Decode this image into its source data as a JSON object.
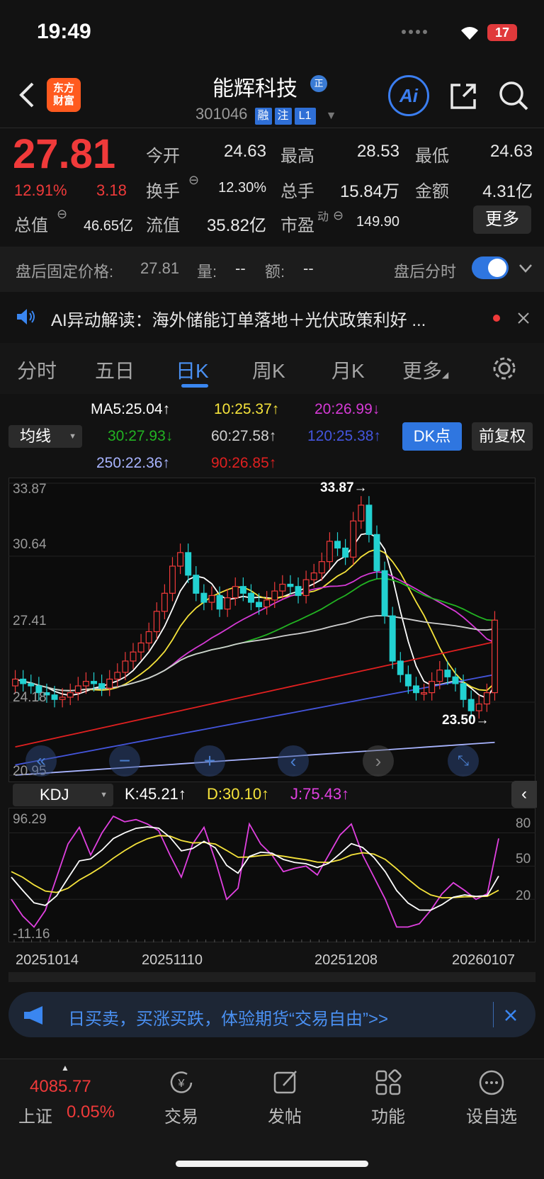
{
  "status_bar": {
    "time": "19:49",
    "battery": "17"
  },
  "header": {
    "logo_line1": "东方",
    "logo_line2": "财富",
    "stock_name": "能辉科技",
    "badge": "正",
    "stock_code": "301046",
    "tags": [
      "融",
      "注",
      "L1"
    ],
    "ai_label": "Ai"
  },
  "quote": {
    "price": "27.81",
    "change_pct": "12.91%",
    "change_amt": "3.18",
    "fields": {
      "open_label": "今开",
      "open": "24.63",
      "high_label": "最高",
      "high": "28.53",
      "low_label": "最低",
      "low": "24.63",
      "turnover_label": "换手",
      "turnover": "12.30%",
      "volume_label": "总手",
      "volume": "15.84万",
      "amount_label": "金额",
      "amount": "4.31亿",
      "mktcap_label": "总值",
      "mktcap": "46.65亿",
      "float_label": "流值",
      "float": "35.82亿",
      "pe_label": "市盈",
      "pe_sup": "动",
      "pe": "149.90"
    },
    "more_button": "更多"
  },
  "after_hours": {
    "price_label": "盘后固定价格:",
    "price": "27.81",
    "vol_label": "量:",
    "vol": "--",
    "amt_label": "额:",
    "amt": "--",
    "toggle_label": "盘后分时"
  },
  "news": {
    "text": "AI异动解读：海外储能订单落地＋光伏政策利好 ..."
  },
  "tabs": [
    "分时",
    "五日",
    "日K",
    "周K",
    "月K",
    "更多"
  ],
  "active_tab": "日K",
  "ma": {
    "selector": "均线",
    "ma5": "MA5:25.04↑",
    "ma10": "10:25.37↑",
    "ma20": "20:26.99↓",
    "ma30": "30:27.93↓",
    "ma60": "60:27.58↑",
    "ma120": "120:25.38↑",
    "ma250": "250:22.36↑",
    "ma90": "90:26.85↑",
    "dk_button": "DK点",
    "fuquan_button": "前复权",
    "colors": {
      "ma5": "#ffffff",
      "ma10": "#f5e33b",
      "ma20": "#d63ad6",
      "ma30": "#22b322",
      "ma60": "#d0d0d0",
      "ma120": "#4455dd",
      "ma250": "#a8b4ff",
      "ma90": "#e02020"
    }
  },
  "chart_data": [
    {
      "type": "candlestick",
      "y_ticks": [
        "33.87",
        "30.64",
        "27.41",
        "24.18",
        "20.95"
      ],
      "ylim": [
        20.95,
        33.87
      ],
      "annotations": {
        "high": "33.87→",
        "low": "23.50→"
      },
      "closes": [
        25.2,
        25.0,
        24.9,
        24.6,
        24.5,
        24.3,
        24.4,
        24.6,
        24.9,
        25.1,
        25.0,
        24.8,
        25.2,
        25.5,
        26.0,
        26.4,
        26.8,
        27.3,
        28.2,
        29.0,
        30.2,
        30.8,
        29.8,
        29.0,
        28.6,
        28.9,
        28.3,
        28.8,
        29.3,
        29.0,
        28.6,
        28.4,
        28.7,
        29.1,
        29.4,
        29.3,
        28.9,
        29.6,
        29.9,
        30.4,
        31.3,
        31.0,
        30.6,
        32.2,
        32.9,
        31.6,
        30.0,
        28.0,
        26.0,
        25.4,
        24.9,
        24.6,
        24.6,
        25.1,
        25.6,
        25.3,
        25.0,
        24.3,
        23.8,
        24.1,
        24.6,
        27.81
      ]
    },
    {
      "type": "line",
      "name": "KDJ",
      "y_ticks": [
        "96.29",
        "-11.16"
      ],
      "right_ticks": [
        "80",
        "50",
        "20"
      ],
      "selector": "KDJ",
      "k_label": "K:45.21↑",
      "d_label": "D:30.10↑",
      "j_label": "J:75.43↑",
      "x_labels": [
        "20251014",
        "20251110",
        "20251208",
        "20260107"
      ]
    }
  ],
  "promo": {
    "text": "日买卖，买涨买跌，体验期货“交易自由”>>"
  },
  "bottom_nav": {
    "index_value": "4085.77",
    "index_name": "上证",
    "index_pct": "0.05%",
    "items": [
      "交易",
      "发帖",
      "功能",
      "设自选"
    ]
  }
}
